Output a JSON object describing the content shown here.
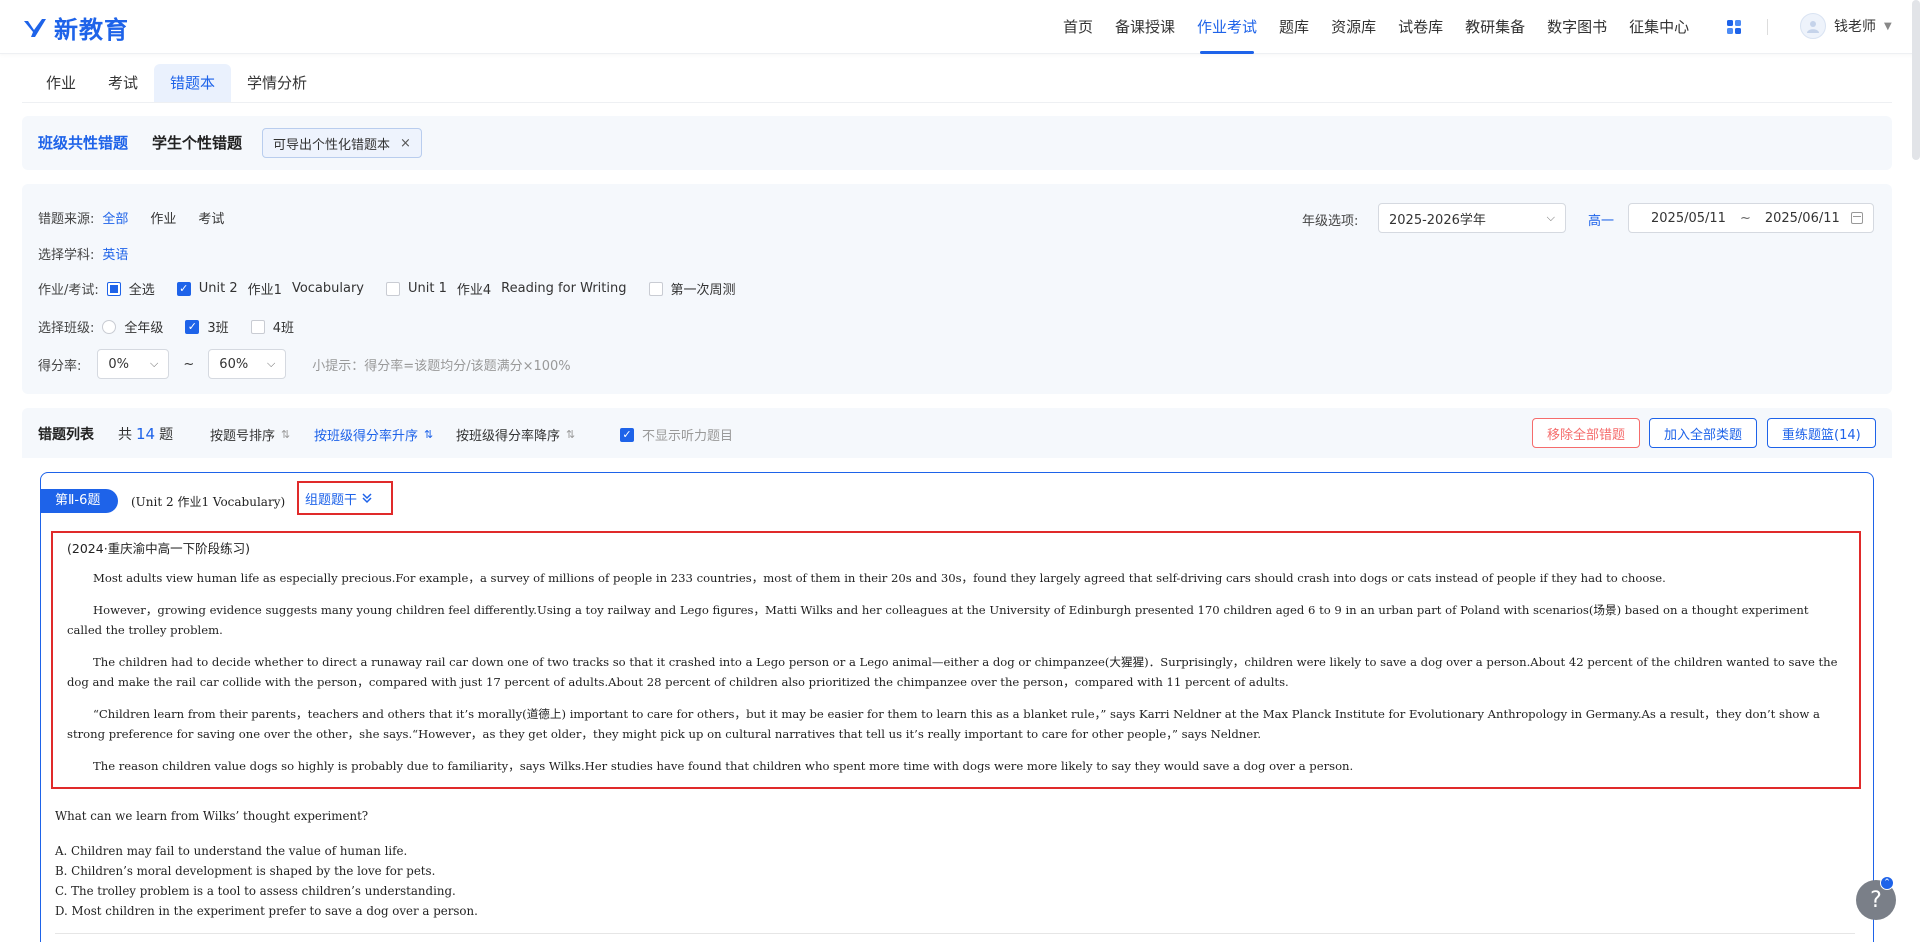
{
  "header": {
    "logo_text": "新教育",
    "nav": [
      "首页",
      "备课授课",
      "作业考试",
      "题库",
      "资源库",
      "试卷库",
      "教研集备",
      "数字图书",
      "征集中心"
    ],
    "nav_active": "作业考试",
    "user_name": "钱老师",
    "accent": "#1e63e9"
  },
  "tabs": {
    "items": [
      "作业",
      "考试",
      "错题本",
      "学情分析"
    ],
    "active": "错题本"
  },
  "mode": {
    "class_common": "班级共性错题",
    "student_personal": "学生个性错题",
    "chip": "可导出个性化错题本"
  },
  "filters": {
    "source_label": "错题来源:",
    "source_options": [
      "全部",
      "作业",
      "考试"
    ],
    "subject_label": "选择学科:",
    "subject": "英语",
    "task_label": "作业/考试:",
    "task_all": "全选",
    "tasks": [
      {
        "unit": "Unit 2",
        "hw": "作业1",
        "name": "Vocabulary"
      },
      {
        "unit": "Unit 1",
        "hw": "作业4",
        "name": "Reading for Writing"
      },
      {
        "name": "第一次周测"
      }
    ],
    "class_label": "选择班级:",
    "class_options": [
      "全年级",
      "3班",
      "4班"
    ],
    "score_label": "得分率:",
    "score_min": "0%",
    "score_tilde": "~",
    "score_max": "60%",
    "hint": "小提示：得分率=该题均分/该题满分×100%",
    "year_label": "年级选项:",
    "year": "2025-2026学年",
    "grade": "高一",
    "date_start": "2025/05/11",
    "date_tilde": "~",
    "date_end": "2025/06/11"
  },
  "list": {
    "title": "错题列表",
    "count_prefix": "共",
    "count": "14",
    "count_suffix": "题",
    "sort_by_number": "按题号排序",
    "sort_asc": "按班级得分率升序",
    "sort_desc": "按班级得分率降序",
    "hide_listening": "不显示听力题目",
    "btn_remove_all": "移除全部错题",
    "btn_add_all": "加入全部类题",
    "btn_retrain": "重练题篮(14)"
  },
  "question": {
    "badge": "第Ⅱ-6题",
    "source": "(Unit 2   作业1   Vocabulary)",
    "stem_toggle": "组题题干",
    "passage_source": "(2024·重庆渝中高一下阶段练习)",
    "paragraphs": [
      "Most adults view human life as especially precious.For example，a survey of millions of people in 233 countries，most of them in their 20s and 30s，found they largely agreed that self-driving cars should crash into dogs or cats instead of people if they had to choose.",
      "However，growing evidence suggests many young children feel differently.Using a toy railway and Lego figures，Matti Wilks and her colleagues at the University of Edinburgh presented 170 children aged 6 to 9 in an urban part of Poland with scenarios(场景) based on a thought experiment called the trolley problem.",
      "The children had to decide whether to direct a runaway rail car down one of two tracks so that it crashed into a Lego person or a Lego animal—either a dog or chimpanzee(大猩猩)．Surprisingly，children were likely to save a dog over a person.About 42 percent of the children wanted to save the dog and make the rail car collide with the person，compared with just 17 percent of adults.About 28 percent of children also prioritized the chimpanzee over the person，compared with 11 percent of adults.",
      "“Children learn from their parents，teachers and others that it’s morally(道德上) important to care for others，but it may be easier for them to learn this as a blanket rule，” says Karri Neldner at the Max Planck Institute for Evolutionary Anthropology in Germany.As a result，they don’t show a strong preference for saving one over the other，she says.“However，as they get older，they might pick up on cultural narratives that tell us it’s really important to care for other people，” says Neldner.",
      "The reason children value dogs so highly is probably due to familiarity，says Wilks.Her studies have found that children who spent more time with dogs were more likely to say they would save a dog over a person."
    ],
    "prompt": "What can we learn from Wilks’ thought experiment?",
    "options": [
      "A. Children may fail to understand the value of human life.",
      "B. Children’s moral development is shaped by the love for pets.",
      "C. The trolley problem is a tool to assess children’s understanding.",
      "D. Most children in the experiment prefer to save a dog over a person."
    ]
  },
  "help": "?"
}
